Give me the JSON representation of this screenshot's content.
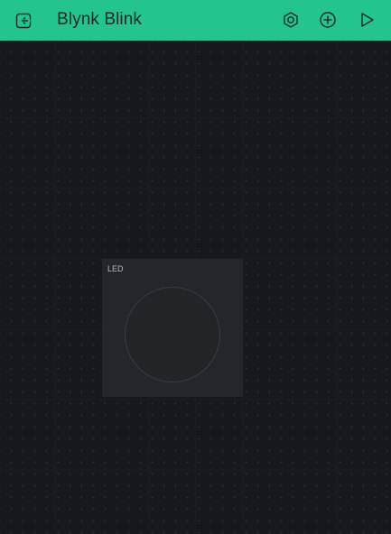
{
  "header": {
    "title": "Blynk Blink",
    "background_color": "#23c48e",
    "icons": {
      "exit": "exit-icon",
      "settings": "hexagon-settings-icon",
      "add": "add-circle-icon",
      "play": "play-icon"
    }
  },
  "canvas": {
    "background_color": "#17181d"
  },
  "widgets": [
    {
      "type": "LED",
      "label": "LED"
    }
  ]
}
